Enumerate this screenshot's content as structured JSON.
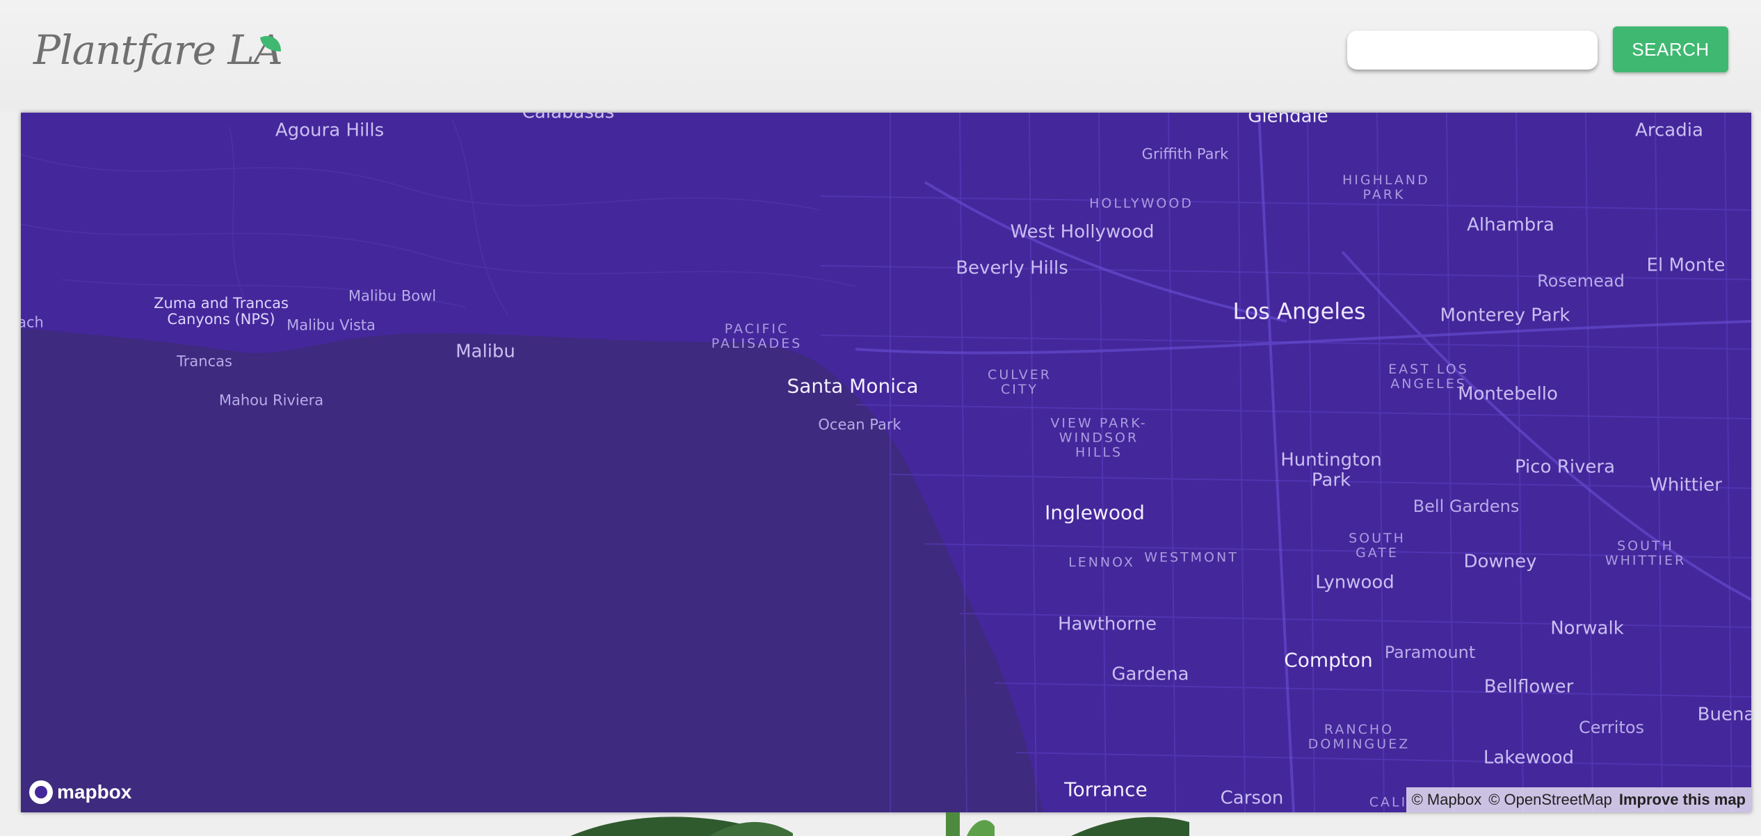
{
  "app": {
    "brand_title": "Plantfare LA",
    "logo_icon": "leaf-icon",
    "accent_color": "#3fb871"
  },
  "search": {
    "value": "",
    "placeholder": "",
    "button_label": "SEARCH"
  },
  "map": {
    "background_color": "#44279a",
    "ocean_color": "#3e2a7e",
    "labels": {
      "calabasas": "Calabasas",
      "agoura_hills": "Agoura Hills",
      "glendale": "Glendale",
      "griffith_park": "Griffith Park",
      "arcadia": "Arcadia",
      "highland_park": "HIGHLAND PARK",
      "hollywood": "HOLLYWOOD",
      "west_hollywood": "West Hollywood",
      "alhambra": "Alhambra",
      "beverly_hills": "Beverly Hills",
      "el_monte": "El Monte",
      "rosemead": "Rosemead",
      "zuma": "Zuma and Trancas Canyons (NPS)",
      "malibu_bowl": "Malibu Bowl",
      "los_angeles": "Los Angeles",
      "monterey_park": "Monterey Park",
      "each": "ach",
      "malibu_vista": "Malibu Vista",
      "pacific_palisades": "PACIFIC PALISADES",
      "malibu": "Malibu",
      "trancas": "Trancas",
      "culver_city": "CULVER CITY",
      "east_los_angeles": "EAST LOS ANGELES",
      "santa_monica": "Santa Monica",
      "montebello": "Montebello",
      "mahou_riviera": "Mahou Riviera",
      "ocean_park": "Ocean Park",
      "view_park": "VIEW PARK-WINDSOR HILLS",
      "huntington_park": "Huntington Park",
      "pico_rivera": "Pico Rivera",
      "whittier": "Whittier",
      "bell_gardens": "Bell Gardens",
      "inglewood": "Inglewood",
      "south_gate": "SOUTH GATE",
      "south_whittier": "SOUTH WHITTIER",
      "lennox": "LENNOX",
      "westmont": "WESTMONT",
      "downey": "Downey",
      "lynwood": "Lynwood",
      "hawthorne": "Hawthorne",
      "norwalk": "Norwalk",
      "compton": "Compton",
      "paramount": "Paramount",
      "gardena": "Gardena",
      "bellflower": "Bellflower",
      "cerritos": "Cerritos",
      "buena": "Buena",
      "rancho_dominguez": "RANCHO DOMINGUEZ",
      "lakewood": "Lakewood",
      "torrance": "Torrance",
      "carson": "Carson",
      "cali": "CALI"
    },
    "logo_text": "mapbox",
    "attribution": {
      "mapbox": "© Mapbox",
      "osm": "© OpenStreetMap",
      "improve": "Improve this map"
    }
  }
}
